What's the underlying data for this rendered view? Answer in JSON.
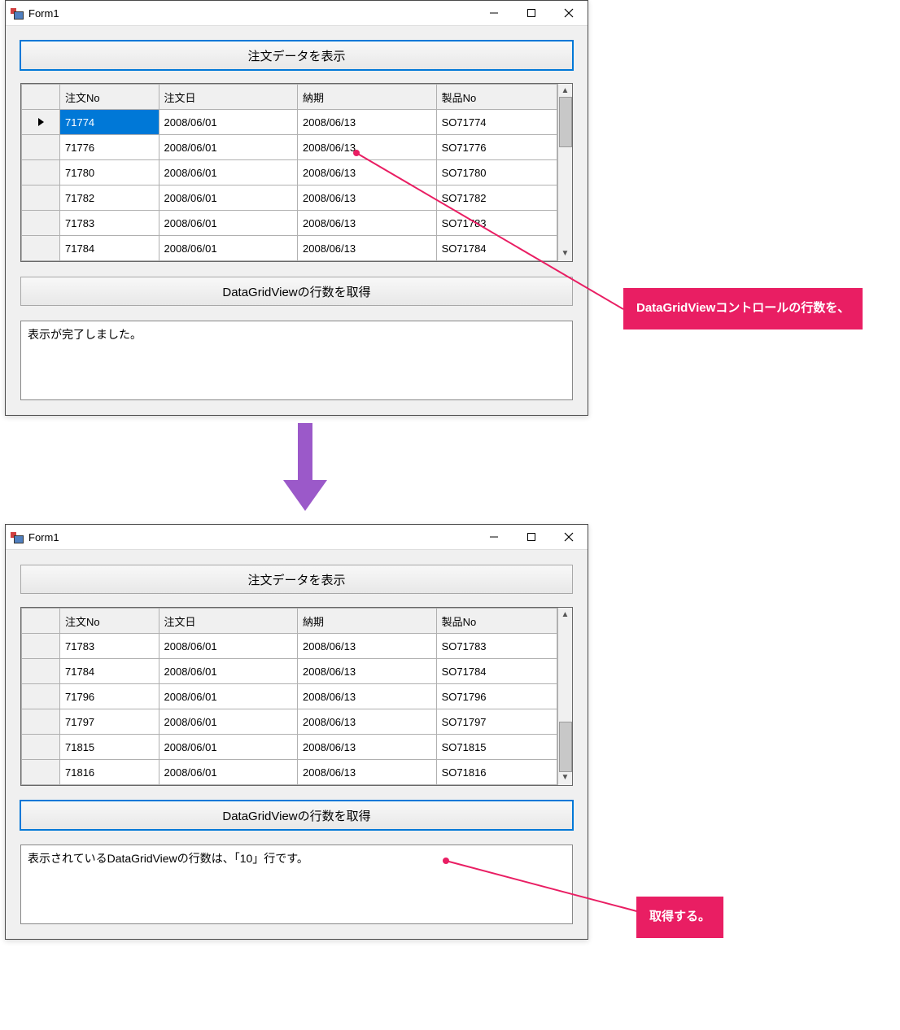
{
  "window1": {
    "title": "Form1",
    "btn_display": "注文データを表示",
    "btn_count": "DataGridViewの行数を取得",
    "output_text": "表示が完了しました。",
    "columns": [
      "注文No",
      "注文日",
      "納期",
      "製品No"
    ],
    "selected_row_index": 0,
    "selected_col_index": 0,
    "scroll_thumb_pos": "top",
    "rows": [
      {
        "no": "71774",
        "date": "2008/06/01",
        "due": "2008/06/13",
        "prod": "SO71774"
      },
      {
        "no": "71776",
        "date": "2008/06/01",
        "due": "2008/06/13",
        "prod": "SO71776"
      },
      {
        "no": "71780",
        "date": "2008/06/01",
        "due": "2008/06/13",
        "prod": "SO71780"
      },
      {
        "no": "71782",
        "date": "2008/06/01",
        "due": "2008/06/13",
        "prod": "SO71782"
      },
      {
        "no": "71783",
        "date": "2008/06/01",
        "due": "2008/06/13",
        "prod": "SO71783"
      },
      {
        "no": "71784",
        "date": "2008/06/01",
        "due": "2008/06/13",
        "prod": "SO71784"
      }
    ]
  },
  "window2": {
    "title": "Form1",
    "btn_display": "注文データを表示",
    "btn_count": "DataGridViewの行数を取得",
    "output_text": "表示されているDataGridViewの行数は、「10」行です。",
    "columns": [
      "注文No",
      "注文日",
      "納期",
      "製品No"
    ],
    "scroll_thumb_pos": "bottom",
    "rows": [
      {
        "no": "71783",
        "date": "2008/06/01",
        "due": "2008/06/13",
        "prod": "SO71783"
      },
      {
        "no": "71784",
        "date": "2008/06/01",
        "due": "2008/06/13",
        "prod": "SO71784"
      },
      {
        "no": "71796",
        "date": "2008/06/01",
        "due": "2008/06/13",
        "prod": "SO71796"
      },
      {
        "no": "71797",
        "date": "2008/06/01",
        "due": "2008/06/13",
        "prod": "SO71797"
      },
      {
        "no": "71815",
        "date": "2008/06/01",
        "due": "2008/06/13",
        "prod": "SO71815"
      },
      {
        "no": "71816",
        "date": "2008/06/01",
        "due": "2008/06/13",
        "prod": "SO71816"
      }
    ]
  },
  "callout1": "DataGridViewコントロールの行数を、",
  "callout2": "取得する。"
}
